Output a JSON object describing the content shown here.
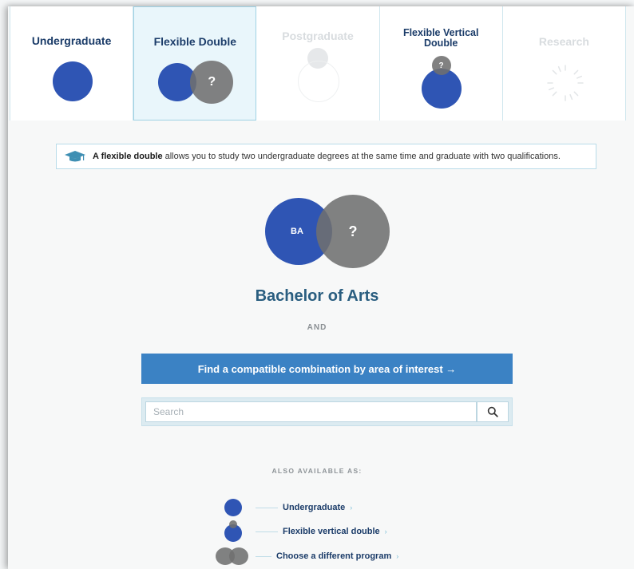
{
  "tabs": [
    {
      "label": "Undergraduate",
      "state": "normal"
    },
    {
      "label": "Flexible Double",
      "state": "active",
      "icon_text": "?"
    },
    {
      "label": "Postgraduate",
      "state": "disabled"
    },
    {
      "label": "Flexible Vertical Double",
      "state": "normal",
      "icon_text": "?"
    },
    {
      "label": "Research",
      "state": "disabled"
    }
  ],
  "info": {
    "bold": "A flexible double",
    "text": "allows you to study two undergraduate degrees at the same time and graduate with two qualifications."
  },
  "venn": {
    "left_text": "BA",
    "right_text": "?"
  },
  "degree_title": "Bachelor of Arts",
  "and_label": "AND",
  "cta_label": "Find a compatible combination by area of interest →",
  "search": {
    "placeholder": "Search",
    "value": ""
  },
  "also": {
    "heading": "ALSO AVAILABLE AS:",
    "items": [
      {
        "label": "Undergraduate"
      },
      {
        "label": "Flexible vertical double"
      },
      {
        "label": "Choose a different program"
      }
    ],
    "chevron": "›"
  },
  "colors": {
    "blue": "#2f55b4",
    "grey": "#707070",
    "accent": "#3b82c4",
    "title": "#2a5e80"
  }
}
